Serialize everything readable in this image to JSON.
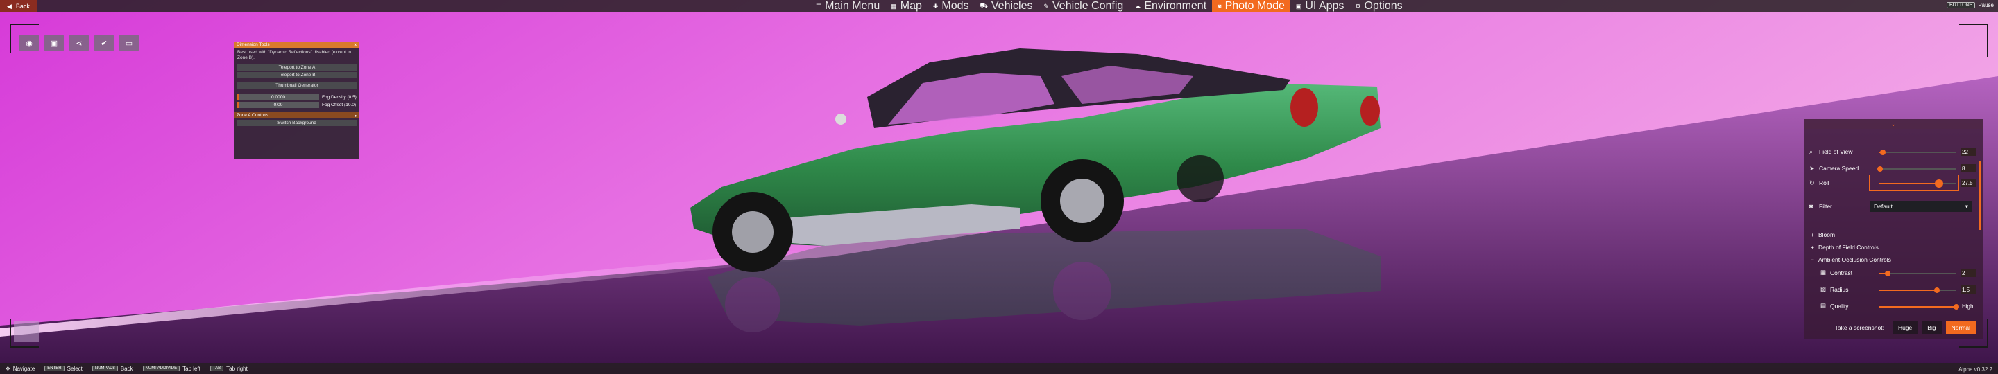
{
  "topbar": {
    "back_label": "Back",
    "nav": [
      {
        "label": "Main Menu",
        "icon": "menu-icon",
        "active": false
      },
      {
        "label": "Map",
        "icon": "map-icon",
        "active": false
      },
      {
        "label": "Mods",
        "icon": "mods-icon",
        "active": false
      },
      {
        "label": "Vehicles",
        "icon": "car-icon",
        "active": false
      },
      {
        "label": "Vehicle Config",
        "icon": "wrench-icon",
        "active": false
      },
      {
        "label": "Environment",
        "icon": "environment-icon",
        "active": false
      },
      {
        "label": "Photo Mode",
        "icon": "camera-icon",
        "active": true
      },
      {
        "label": "UI Apps",
        "icon": "apps-icon",
        "active": false
      },
      {
        "label": "Options",
        "icon": "gear-icon",
        "active": false
      }
    ],
    "right_badge": "BUTTONS",
    "right_label": "Pause"
  },
  "tools": [
    {
      "icon": "camera-icon",
      "glyph": "◉"
    },
    {
      "icon": "image-icon",
      "glyph": "▣"
    },
    {
      "icon": "share-icon",
      "glyph": "⋖"
    },
    {
      "icon": "check-icon",
      "glyph": "✔"
    },
    {
      "icon": "folder-icon",
      "glyph": "▭"
    }
  ],
  "dimension_tools": {
    "title": "Dimension Tools",
    "note": "Best used with \"Dynamic Reflections\" disabled (except in Zone B).",
    "buttons": [
      "Teleport to Zone A",
      "Teleport to Zone B",
      "Thumbnail Generator"
    ],
    "fog_density": {
      "value": "0.0000",
      "label": "Fog Density (0.5)",
      "fraction": 0.02
    },
    "fog_offset": {
      "value": "0.00",
      "label": "Fog Offset (10.0)",
      "fraction": 0.0
    },
    "section": "Zone A Controls",
    "switch_label": "Switch Background"
  },
  "panel": {
    "field_of_view": {
      "label": "Field of View",
      "value": "22",
      "fraction": 0.05
    },
    "camera_speed": {
      "label": "Camera Speed",
      "value": "8",
      "fraction": 0.02
    },
    "roll": {
      "label": "Roll",
      "value": "27.5",
      "fraction": 0.78
    },
    "filter": {
      "label": "Filter",
      "value": "Default"
    },
    "bloom": "Bloom",
    "dof": "Depth of Field Controls",
    "ao": "Ambient Occlusion Controls",
    "contrast": {
      "label": "Contrast",
      "value": "2",
      "fraction": 0.12
    },
    "radius": {
      "label": "Radius",
      "value": "1.5",
      "fraction": 0.75
    },
    "quality": {
      "label": "Quality",
      "value": "High",
      "fraction": 1.0
    },
    "screenshot_label": "Take a screenshot:",
    "screenshot_sizes": [
      {
        "label": "Huge",
        "active": false
      },
      {
        "label": "Big",
        "active": false
      },
      {
        "label": "Normal",
        "active": true
      }
    ]
  },
  "bottombar": {
    "items": [
      {
        "key": "",
        "label": "Navigate"
      },
      {
        "key": "ENTER",
        "label": "Select"
      },
      {
        "key": "NUMPAD8",
        "label": "Back"
      },
      {
        "key": "NUMPADDIVIDE",
        "label": "Tab left"
      },
      {
        "key": "TAB",
        "label": "Tab right"
      }
    ],
    "version": "Alpha v0.32.2"
  },
  "colors": {
    "accent": "#f26a1f",
    "sky_left": "#e052dc",
    "sky_right": "#f4a8e8",
    "car_green": "#2f8a4a"
  }
}
